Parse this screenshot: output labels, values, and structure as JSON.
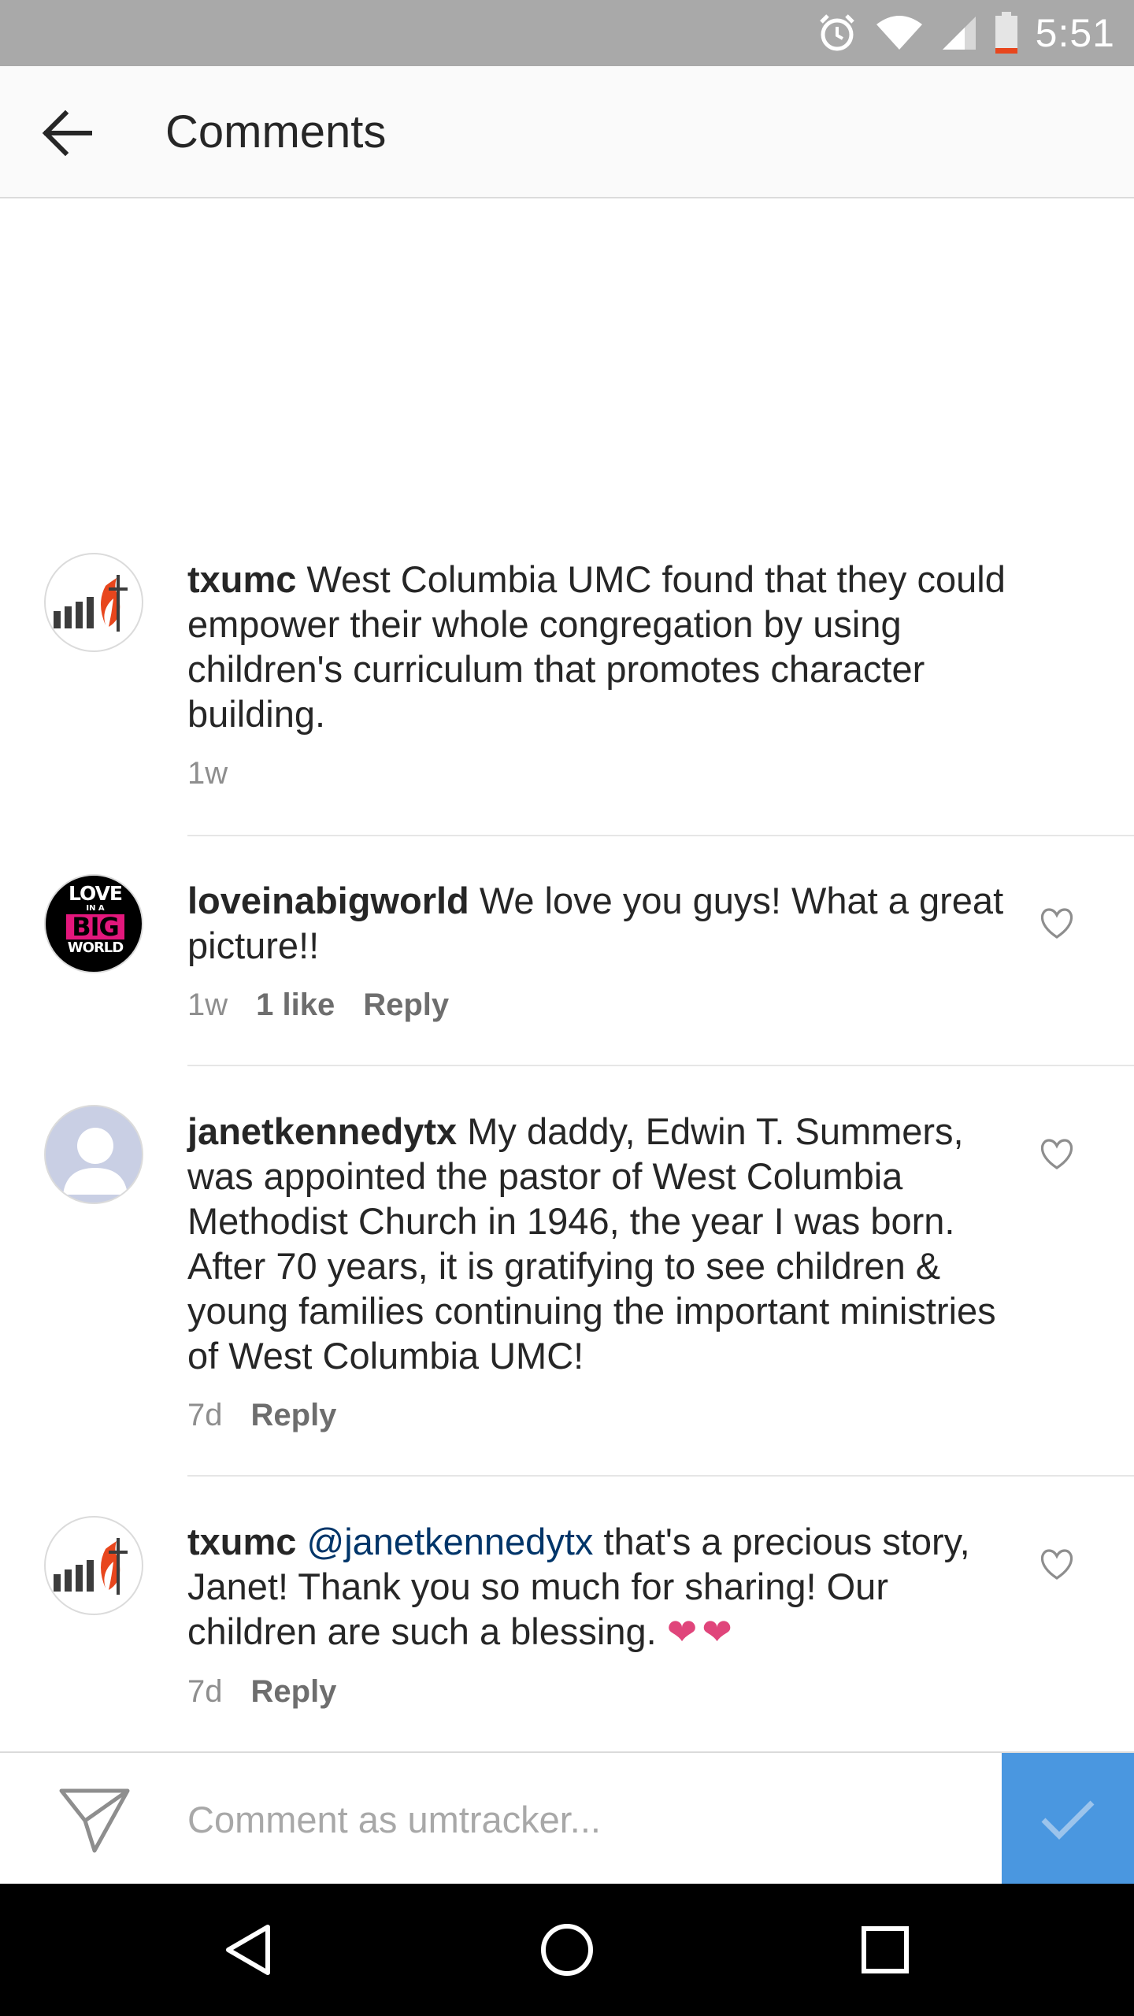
{
  "status_bar": {
    "time": "5:51",
    "icons": [
      "alarm-icon",
      "wifi-icon",
      "signal-icon",
      "battery-icon"
    ]
  },
  "header": {
    "title": "Comments",
    "back_icon": "arrow-left-icon"
  },
  "comments": [
    {
      "username": "txumc",
      "text": "West Columbia UMC found that they could empower their whole congregation by using children's curriculum that promotes character building.",
      "time": "1w"
    },
    {
      "username": "loveinabigworld",
      "text": "We love you guys! What a great picture!!",
      "time": "1w",
      "likes": "1 like",
      "reply": "Reply",
      "avatar_text": [
        "LOVE",
        "IN A",
        "BIG",
        "WORLD"
      ]
    },
    {
      "username": "janetkennedytx",
      "text": "My daddy, Edwin T. Summers, was appointed the pastor of West Columbia Methodist Church in 1946, the year I was born. After 70 years, it is gratifying to see children &  young families continuing the important ministries of West Columbia UMC!",
      "time": "7d",
      "reply": "Reply"
    },
    {
      "username": "txumc",
      "mention": "@janetkennedytx",
      "text": "that's a precious story, Janet! Thank you so much for sharing! Our children are such a blessing.",
      "emoji": "❤❤",
      "time": "7d",
      "reply": "Reply"
    }
  ],
  "composer": {
    "placeholder": "Comment as umtracker..."
  },
  "colors": {
    "status_bar": "#a9a9a9",
    "post_button": "#4a97e0",
    "mention": "#003569",
    "heart_emoji": "#e0457b"
  }
}
